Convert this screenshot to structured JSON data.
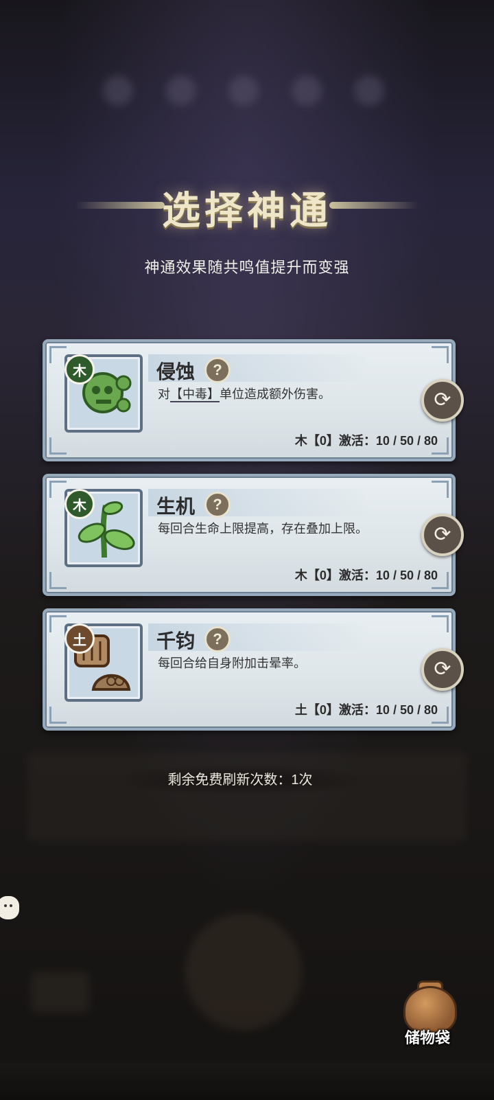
{
  "title": "选择神通",
  "subtitle": "神通效果随共鸣值提升而变强",
  "cards": [
    {
      "element": "木",
      "element_color": "#2f5a2b",
      "icon": "poison-slime-icon",
      "name": "侵蚀",
      "help": "?",
      "desc_pre": "对",
      "desc_tag": "【中毒】",
      "desc_post": "单位造成额外伤害。",
      "activation": "木【0】激活：10 / 50 / 80"
    },
    {
      "element": "木",
      "element_color": "#2f5a2b",
      "icon": "sprout-icon",
      "name": "生机",
      "help": "?",
      "desc_pre": "每回合生命上限提高，存在叠加上限。",
      "desc_tag": "",
      "desc_post": "",
      "activation": "木【0】激活：10 / 50 / 80"
    },
    {
      "element": "土",
      "element_color": "#6e4a2e",
      "icon": "fist-stun-icon",
      "name": "千钧",
      "help": "?",
      "desc_pre": "每回合给自身附加击晕率。",
      "desc_tag": "",
      "desc_post": "",
      "activation": "土【0】激活：10 / 50 / 80"
    }
  ],
  "refresh_icon": "refresh-icon",
  "free_refresh": "剩余免费刷新次数：1次",
  "bag_label": "储物袋"
}
